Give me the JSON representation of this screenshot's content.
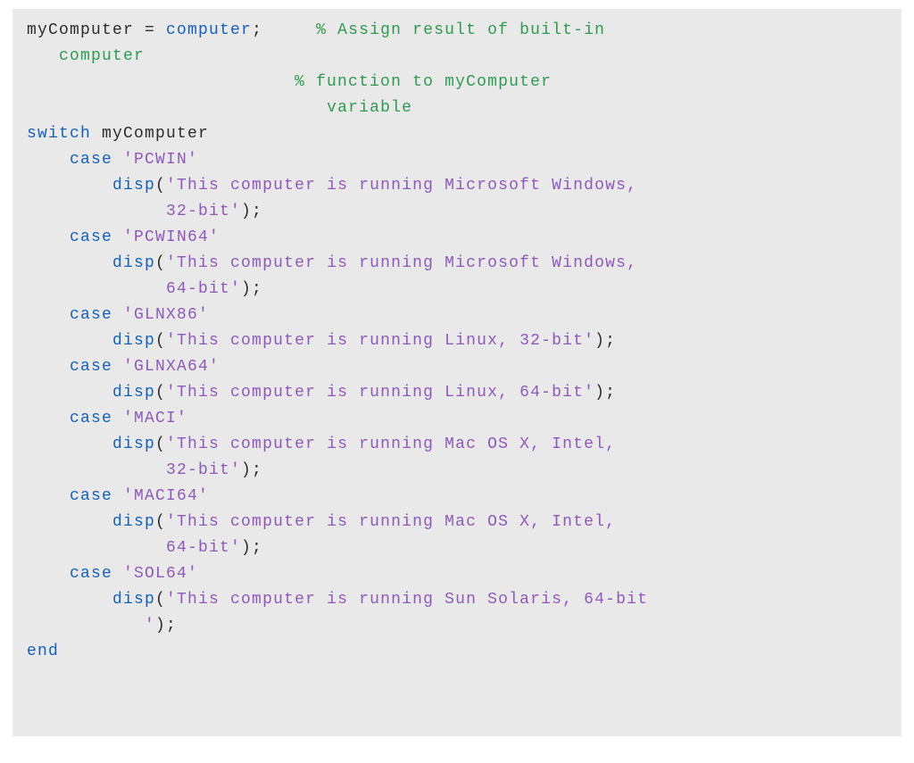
{
  "colors": {
    "background": "#e9e9e9",
    "text": "#2b2b2b",
    "keyword": "#1560b6",
    "comment": "#2e9a4f",
    "string": "#8e59b8"
  },
  "code": {
    "var_assign": {
      "var": "myComputer",
      "eq": " = ",
      "kw": "computer",
      "semi": ";"
    },
    "comment1a": "% Assign result of built-in",
    "comment1b": "computer",
    "comment2a": "% function to myComputer",
    "comment2b": "variable",
    "switch_kw": "switch",
    "switch_var": " myComputer",
    "case_kw": "case",
    "disp_fn": "disp",
    "end_kw": "end",
    "cases": [
      {
        "val": "'PCWIN'",
        "msg_a": "'This computer is running Microsoft Windows,",
        "msg_b": " 32-bit'"
      },
      {
        "val": "'PCWIN64'",
        "msg_a": "'This computer is running Microsoft Windows,",
        "msg_b": " 64-bit'"
      },
      {
        "val": "'GLNX86'",
        "msg_a": "'This computer is running Linux, 32-bit'",
        "msg_b": ""
      },
      {
        "val": "'GLNXA64'",
        "msg_a": "'This computer is running Linux, 64-bit'",
        "msg_b": ""
      },
      {
        "val": "'MACI'",
        "msg_a": "'This computer is running Mac OS X, Intel,",
        "msg_b": " 32-bit'"
      },
      {
        "val": "'MACI64'",
        "msg_a": "'This computer is running Mac OS X, Intel,",
        "msg_b": " 64-bit'"
      },
      {
        "val": "'SOL64'",
        "msg_a": "'This computer is running Sun Solaris, 64-bit",
        "msg_b": "'"
      }
    ]
  }
}
